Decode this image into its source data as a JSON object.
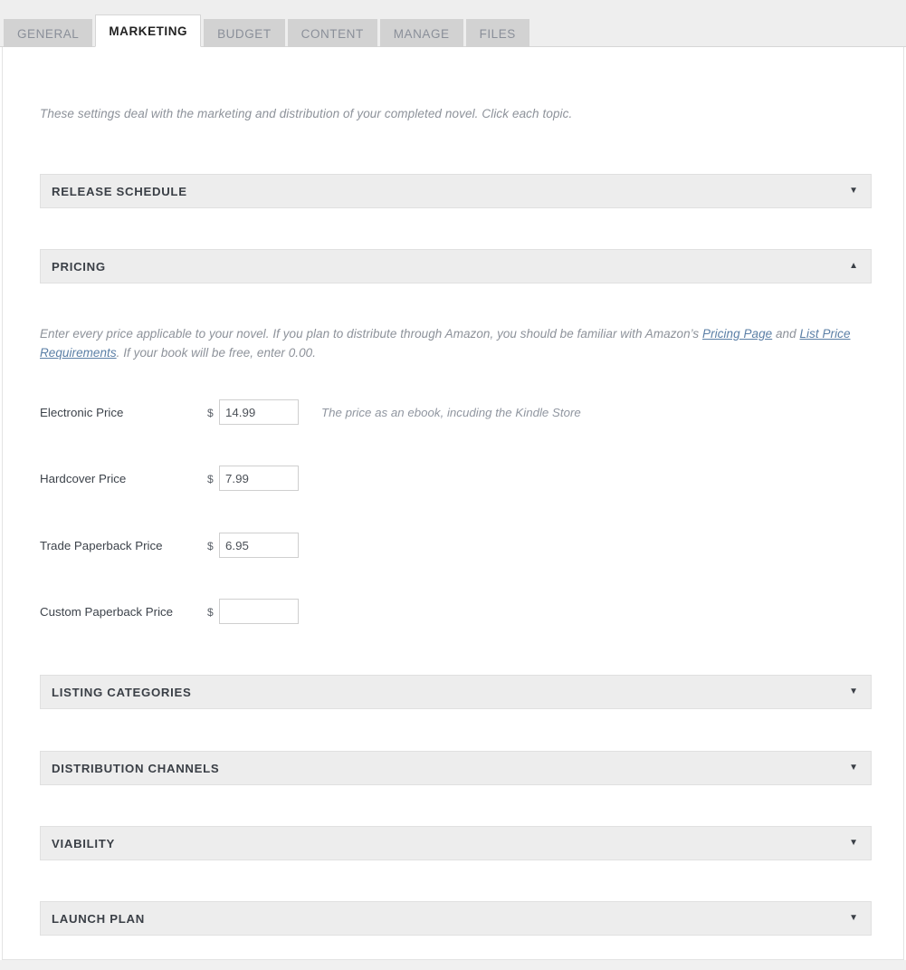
{
  "tabs": [
    {
      "label": "GENERAL",
      "active": false
    },
    {
      "label": "MARKETING",
      "active": true
    },
    {
      "label": "BUDGET",
      "active": false
    },
    {
      "label": "CONTENT",
      "active": false
    },
    {
      "label": "MANAGE",
      "active": false
    },
    {
      "label": "FILES",
      "active": false
    }
  ],
  "intro": "These settings deal with the marketing and distribution of your completed novel. Click each topic.",
  "sections": {
    "release_schedule": {
      "title": "RELEASE SCHEDULE",
      "expanded": false,
      "arrow": "▼"
    },
    "pricing": {
      "title": "PRICING",
      "expanded": true,
      "arrow": "▲"
    },
    "listing_categories": {
      "title": "LISTING CATEGORIES",
      "expanded": false,
      "arrow": "▼"
    },
    "distribution_channels": {
      "title": "DISTRIBUTION CHANNELS",
      "expanded": false,
      "arrow": "▼"
    },
    "viability": {
      "title": "VIABILITY",
      "expanded": false,
      "arrow": "▼"
    },
    "launch_plan": {
      "title": "LAUNCH PLAN",
      "expanded": false,
      "arrow": "▼"
    }
  },
  "pricing": {
    "description": {
      "part1": "Enter every price applicable to your novel. If you plan to distribute through Amazon, you should be familiar with Amazon’s ",
      "link1": "Pricing Page",
      "part2": " and ",
      "link2": "List Price Requirements",
      "part3": ". If your book will be free, enter 0.00."
    },
    "currency_symbol": "$",
    "fields": [
      {
        "label": "Electronic Price",
        "value": "14.99",
        "placeholder": "",
        "hint": "The price as an ebook, incuding the Kindle Store"
      },
      {
        "label": "Hardcover Price",
        "value": "7.99",
        "placeholder": "",
        "hint": ""
      },
      {
        "label": "Trade Paperback Price",
        "value": "6.95",
        "placeholder": "",
        "hint": ""
      },
      {
        "label": "Custom Paperback Price",
        "value": "",
        "placeholder": "",
        "hint": ""
      }
    ]
  },
  "colors": {
    "tabstrip_bg": "#eeeeee",
    "tab_inactive_bg": "#d2d2d2",
    "tab_active_bg": "#ffffff",
    "accordion_bg": "#ededed",
    "link": "#5b7fa6",
    "muted_text": "#8d929a"
  }
}
